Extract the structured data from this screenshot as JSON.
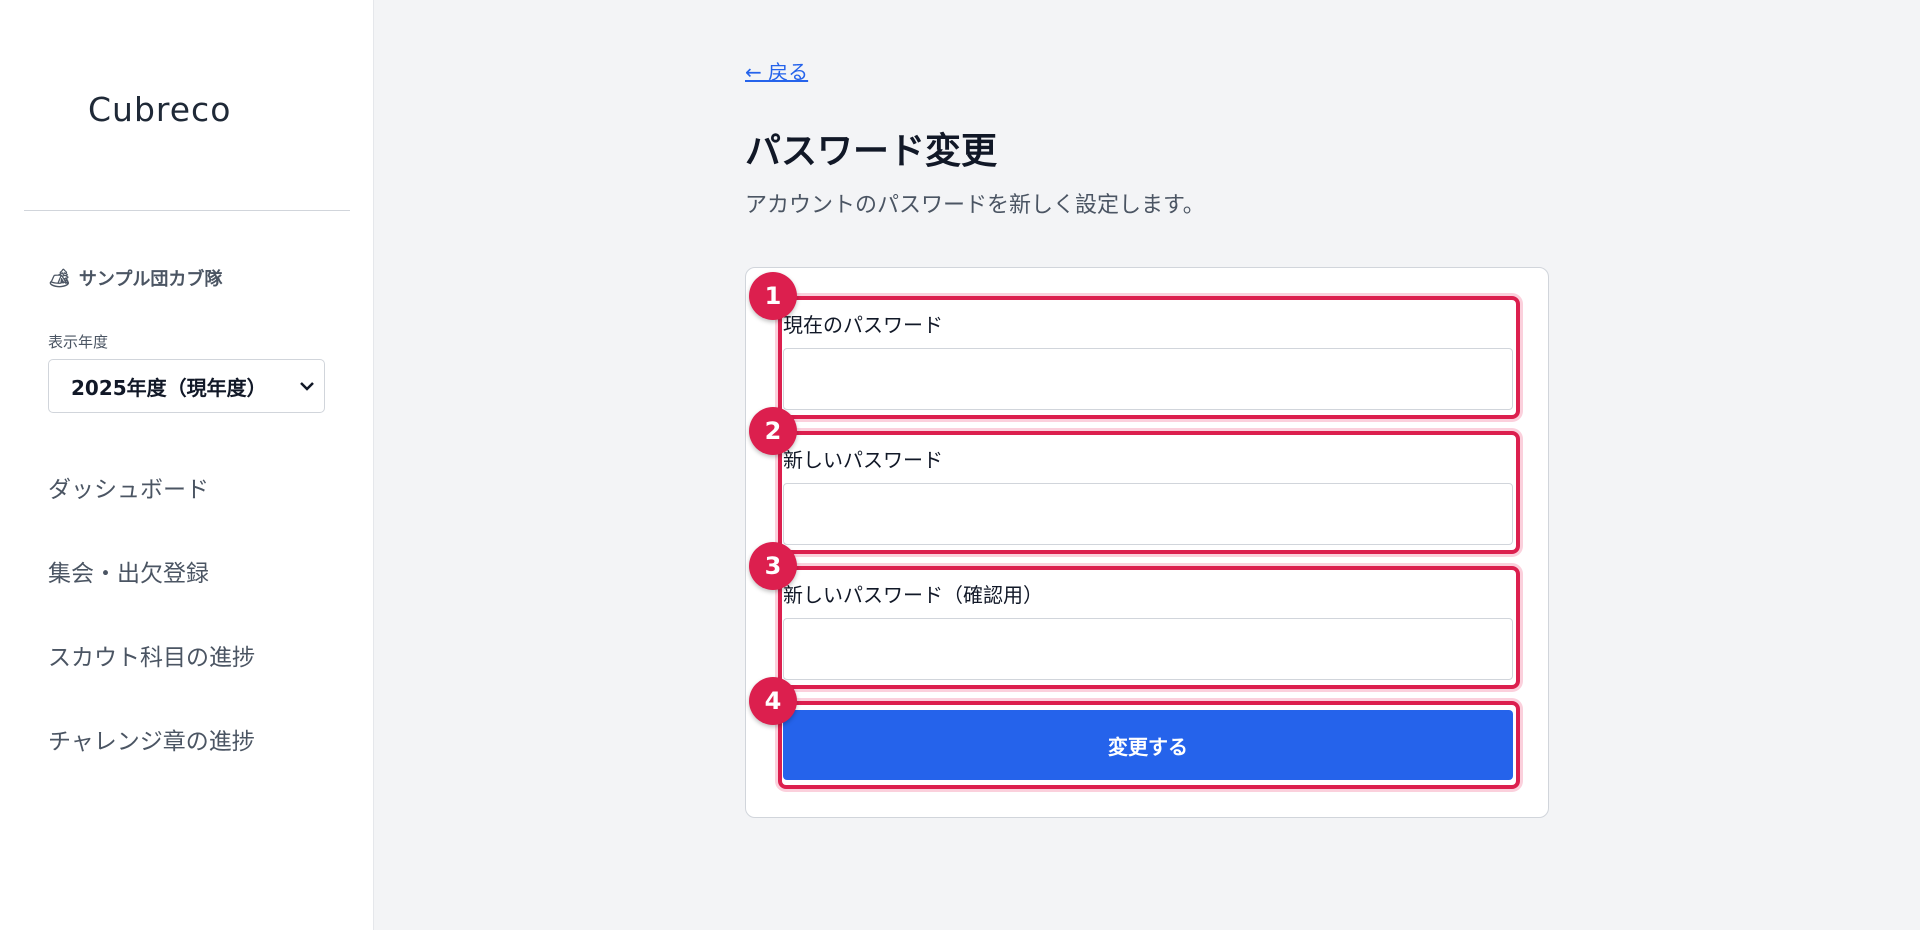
{
  "sidebar": {
    "logo": "Cubreco",
    "team_icon": "🏕",
    "team_name": "サンプル団カブ隊",
    "year_label": "表示年度",
    "year_value": "2025年度（現年度）",
    "nav": [
      {
        "label": "ダッシュボード"
      },
      {
        "label": "集会・出欠登録"
      },
      {
        "label": "スカウト科目の進捗"
      },
      {
        "label": "チャレンジ章の進捗"
      }
    ]
  },
  "main": {
    "back_link": "← 戻る",
    "title": "パスワード変更",
    "subtitle": "アカウントのパスワードを新しく設定します。",
    "fields": [
      {
        "label": "現在のパスワード",
        "value": ""
      },
      {
        "label": "新しいパスワード",
        "value": ""
      },
      {
        "label": "新しいパスワード（確認用）",
        "value": ""
      }
    ],
    "submit_label": "変更する"
  },
  "annotations": [
    "1",
    "2",
    "3",
    "4"
  ],
  "colors": {
    "accent": "#2563eb",
    "highlight": "#dc1f4e",
    "background": "#f3f4f6"
  }
}
